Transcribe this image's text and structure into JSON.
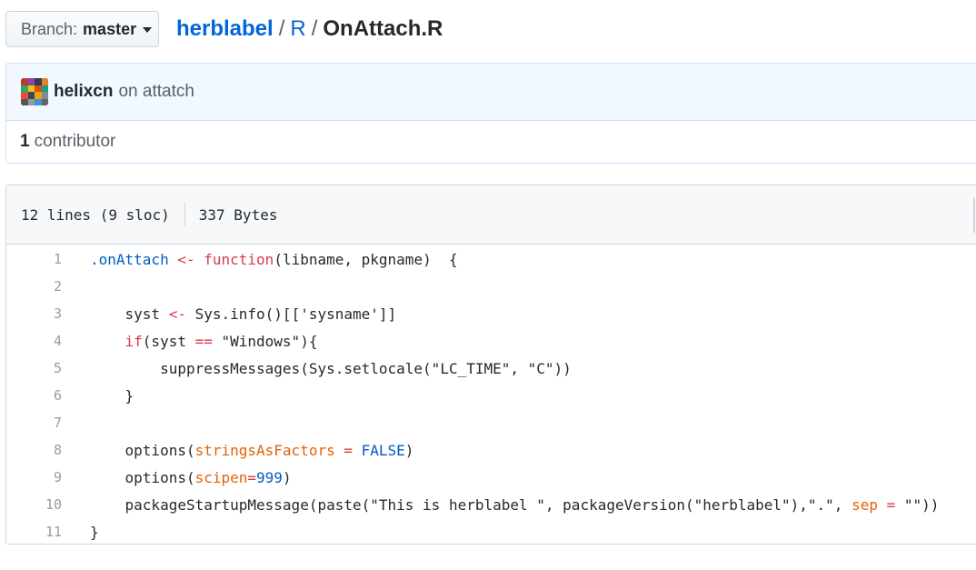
{
  "branch": {
    "label": "Branch:",
    "value": "master"
  },
  "breadcrumb": {
    "repo": "herblabel",
    "sep1": "/",
    "dir": "R",
    "sep2": "/",
    "file": "OnAttach.R"
  },
  "commit": {
    "author": "helixcn",
    "message": "on attatch"
  },
  "contributors": {
    "count": "1",
    "label": "contributor"
  },
  "file_info": {
    "lines": "12 lines (9 sloc)",
    "size": "337 Bytes"
  },
  "colors": {
    "link": "#0366d6",
    "keyword": "#d73a49",
    "function": "#6f42c1",
    "constant": "#005cc5",
    "string": "#032f62",
    "argument": "#e36209"
  },
  "code_lines": [
    {
      "n": "1",
      "tokens": [
        [
          "c",
          ".onAttach"
        ],
        [
          "",
          ""
        ],
        [
          "k",
          " <-"
        ],
        [
          "",
          ""
        ],
        [
          "k",
          " function"
        ],
        [
          "",
          "(libname, pkgname)  {"
        ]
      ]
    },
    {
      "n": "2",
      "tokens": []
    },
    {
      "n": "3",
      "tokens": [
        [
          "",
          "    syst "
        ],
        [
          "k",
          "<-"
        ],
        [
          "",
          " Sys.info()[['sysname']]"
        ]
      ]
    },
    {
      "n": "4",
      "tokens": [
        [
          "k",
          "    if"
        ],
        [
          "",
          "(syst "
        ],
        [
          "k",
          "=="
        ],
        [
          "",
          " \"Windows\"){"
        ]
      ]
    },
    {
      "n": "5",
      "tokens": [
        [
          "",
          "        suppressMessages(Sys.setlocale(\"LC_TIME\", \"C\"))"
        ]
      ]
    },
    {
      "n": "6",
      "tokens": [
        [
          "",
          "    }"
        ]
      ]
    },
    {
      "n": "7",
      "tokens": []
    },
    {
      "n": "8",
      "tokens": [
        [
          "",
          "    options("
        ],
        [
          "a",
          "stringsAsFactors"
        ],
        [
          "k",
          " ="
        ],
        [
          "c",
          " FALSE"
        ],
        [
          "",
          ")"
        ]
      ]
    },
    {
      "n": "9",
      "tokens": [
        [
          "",
          "    options("
        ],
        [
          "a",
          "scipen"
        ],
        [
          "k",
          "="
        ],
        [
          "c",
          "999"
        ],
        [
          "",
          ")"
        ]
      ]
    },
    {
      "n": "10",
      "tokens": [
        [
          "",
          "    packageStartupMessage(paste(\"This is herblabel \", packageVersion(\"herblabel\"),\".\", "
        ],
        [
          "a",
          "sep"
        ],
        [
          "k",
          " ="
        ],
        [
          "",
          " \"\"))"
        ]
      ]
    },
    {
      "n": "11",
      "tokens": [
        [
          "",
          "}"
        ]
      ]
    }
  ]
}
